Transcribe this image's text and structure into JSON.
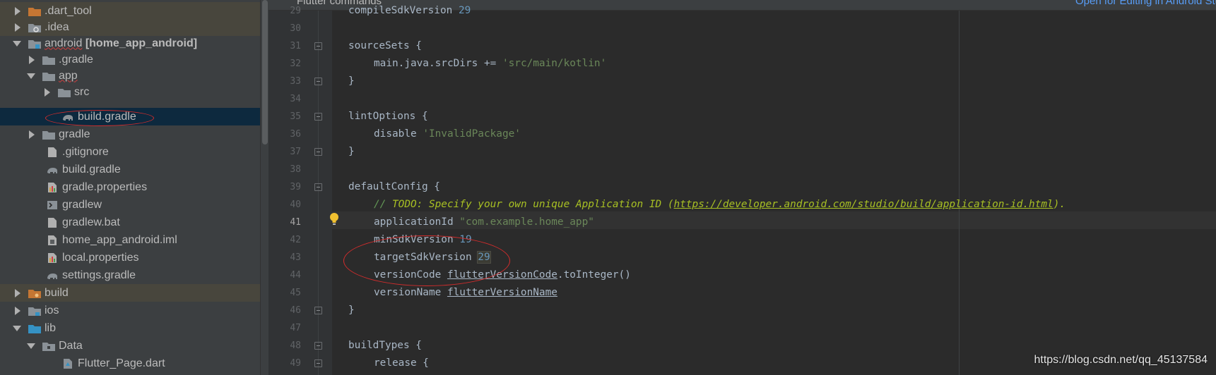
{
  "tree": {
    "items": [
      {
        "label": ".dart_tool"
      },
      {
        "label": ".idea"
      },
      {
        "label": "android",
        "label_bold": "[home_app_android]"
      },
      {
        "label": ".gradle"
      },
      {
        "label": "app"
      },
      {
        "label": "src"
      },
      {
        "label": "build.gradle"
      },
      {
        "label": "gradle"
      },
      {
        "label": ".gitignore"
      },
      {
        "label": "build.gradle"
      },
      {
        "label": "gradle.properties"
      },
      {
        "label": "gradlew"
      },
      {
        "label": "gradlew.bat"
      },
      {
        "label": "home_app_android.iml"
      },
      {
        "label": "local.properties"
      },
      {
        "label": "settings.gradle"
      },
      {
        "label": "build"
      },
      {
        "label": "ios"
      },
      {
        "label": "lib"
      },
      {
        "label": "Data"
      },
      {
        "label": "Flutter_Page.dart"
      }
    ]
  },
  "editor": {
    "tabbar": {
      "left": "Flutter commands",
      "right": "Open for Editing in Android Studio"
    },
    "current_line": "41",
    "lines": [
      {
        "n": "29",
        "t1": "compileSdkVersion ",
        "num": "29"
      },
      {
        "n": "30"
      },
      {
        "n": "31",
        "t1": "sourceSets {"
      },
      {
        "n": "32",
        "t1": "main.java.srcDirs += ",
        "str": "'src/main/kotlin'"
      },
      {
        "n": "33",
        "t1": "}"
      },
      {
        "n": "34"
      },
      {
        "n": "35",
        "t1": "lintOptions {"
      },
      {
        "n": "36",
        "t1": "disable ",
        "str": "'InvalidPackage'"
      },
      {
        "n": "37",
        "t1": "}"
      },
      {
        "n": "38"
      },
      {
        "n": "39",
        "t1": "defaultConfig {"
      },
      {
        "n": "40",
        "cmt": "// ",
        "todo": "TODO: Specify your own unique Application ID (",
        "link": "https://developer.android.com/studio/build/application-id.html",
        "todo_end": ")."
      },
      {
        "n": "41",
        "t1": "applicationId ",
        "str": "\"com.example.home_app\""
      },
      {
        "n": "42",
        "t1": "minSdkVersion ",
        "num": "19"
      },
      {
        "n": "43",
        "t1": "targetSdkVersion ",
        "num": "29"
      },
      {
        "n": "44",
        "t1": "versionCode ",
        "u": "flutterVersionCode",
        "t2": ".toInteger()"
      },
      {
        "n": "45",
        "t1": "versionName ",
        "u": "flutterVersionName"
      },
      {
        "n": "46",
        "t1": "}"
      },
      {
        "n": "47"
      },
      {
        "n": "48",
        "t1": "buildTypes {"
      },
      {
        "n": "49",
        "t1": "release {"
      }
    ]
  },
  "watermark": "https://blog.csdn.net/qq_45137584",
  "colors": {
    "annotation": "#d42c2c",
    "selection": "#0d293e",
    "excluded": "#48463d",
    "folder_orange": "#c57633",
    "folder_gray": "#8a9197",
    "folder_blue": "#3592c4"
  }
}
